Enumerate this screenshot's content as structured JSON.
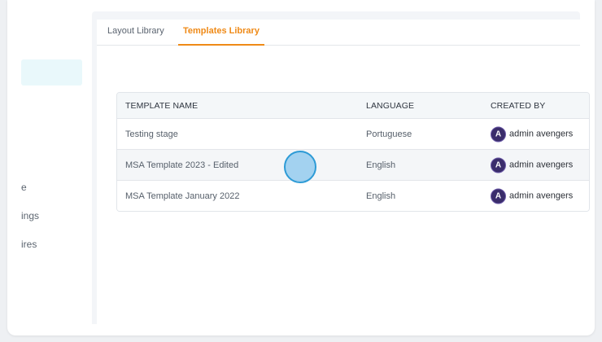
{
  "sidebar": {
    "items": [
      {
        "label": "e"
      },
      {
        "label": "ings"
      },
      {
        "label": "ires"
      }
    ]
  },
  "tabs": [
    {
      "label": "Layout Library",
      "active": false
    },
    {
      "label": "Templates Library",
      "active": true
    }
  ],
  "table": {
    "headers": [
      "TEMPLATE NAME",
      "LANGUAGE",
      "CREATED BY"
    ],
    "rows": [
      {
        "name": "Testing stage",
        "language": "Portuguese",
        "created_by": "admin avengers"
      },
      {
        "name": "MSA Template 2023 - Edited",
        "language": "English",
        "created_by": "admin avengers"
      },
      {
        "name": "MSA Template January 2022",
        "language": "English",
        "created_by": "admin avengers"
      }
    ]
  },
  "colors": {
    "accent": "#ef8a17",
    "sidebar_highlight": "#e9f8fb",
    "cursor": "#2d9bd6"
  }
}
